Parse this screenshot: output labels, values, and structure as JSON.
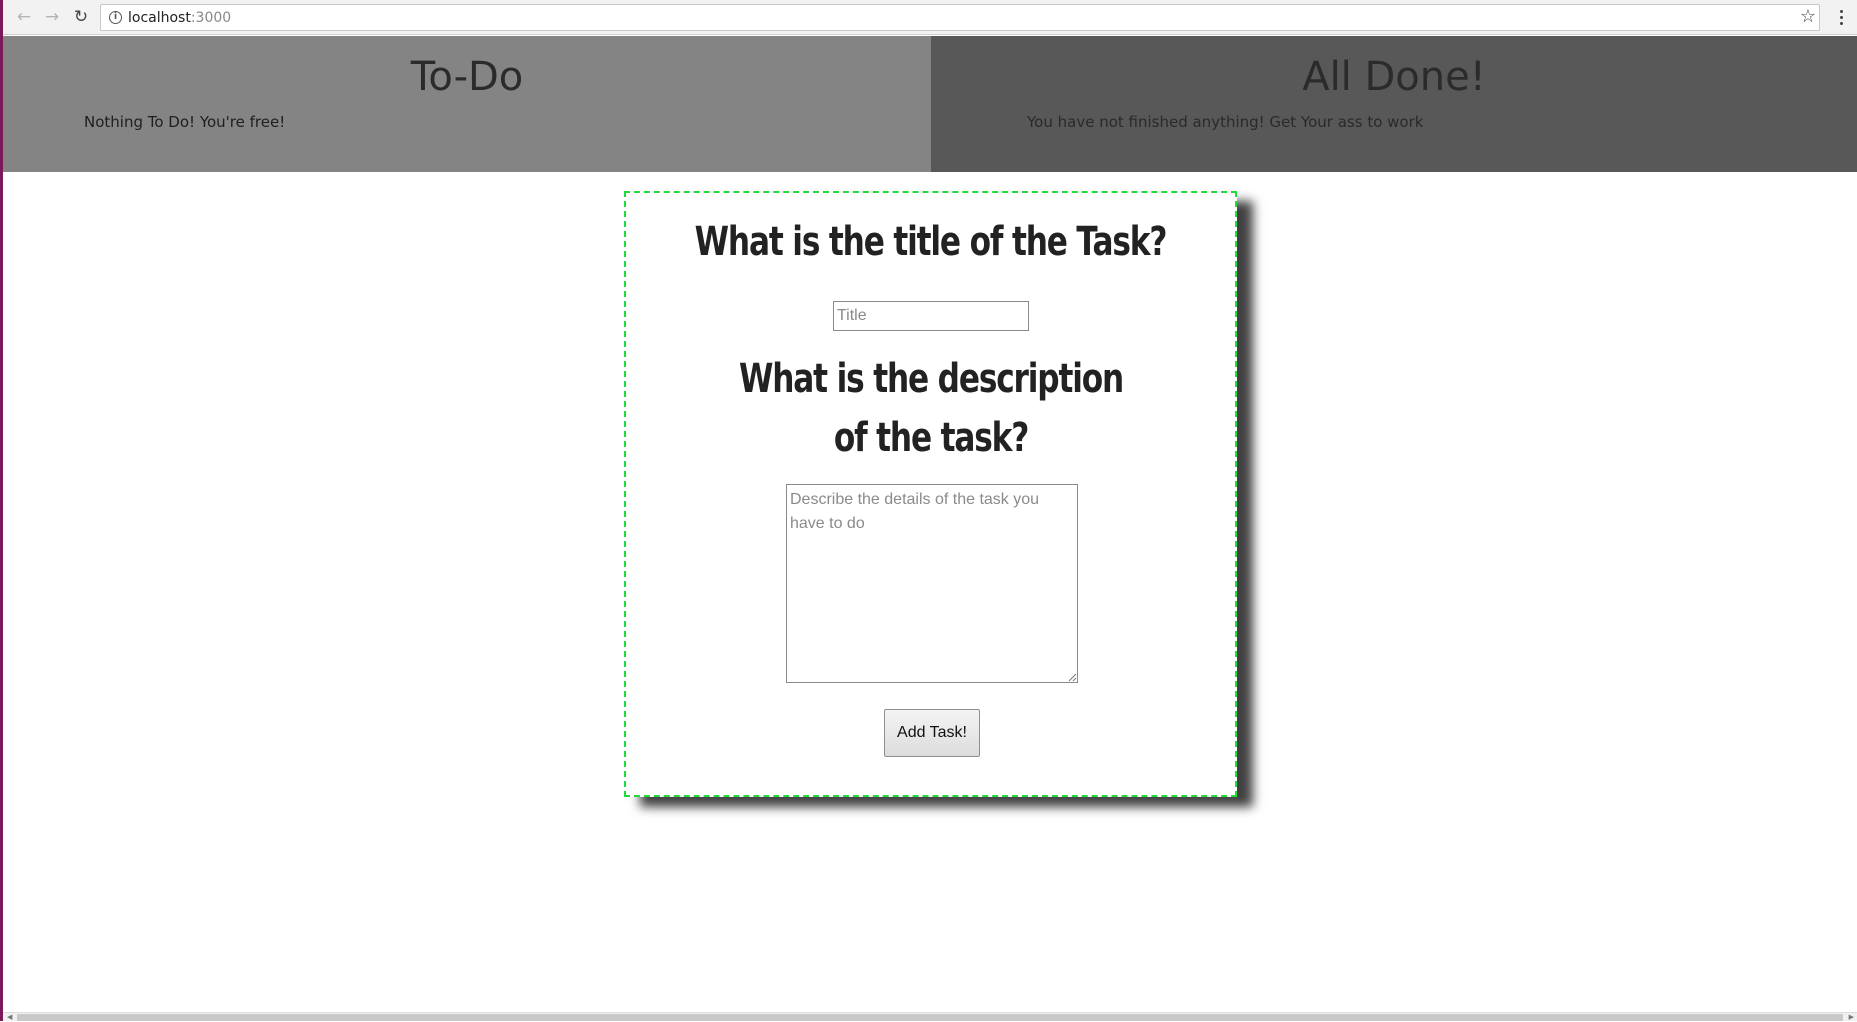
{
  "browser": {
    "back_icon": "arrow-left-icon",
    "forward_icon": "arrow-right-icon",
    "reload_icon": "reload-icon",
    "url_host": "localhost",
    "url_port": ":3000",
    "bookmark_icon": "star-icon",
    "menu_icon": "kebab-menu-icon"
  },
  "todo_panel": {
    "title": "To-Do",
    "message": "Nothing To Do! You're free!",
    "background": "#848484"
  },
  "done_panel": {
    "title": "All Done!",
    "message": "You have not finished anything! Get Your ass to work",
    "background": "#585858"
  },
  "form": {
    "title_heading": "What is the title of the Task?",
    "title_placeholder": "Title",
    "title_value": "",
    "description_heading": "What is the description of the task?",
    "description_placeholder": "Describe the details of the task you have to do",
    "description_value": "",
    "submit_label": "Add Task!",
    "border_color": "#1fdc3a"
  }
}
